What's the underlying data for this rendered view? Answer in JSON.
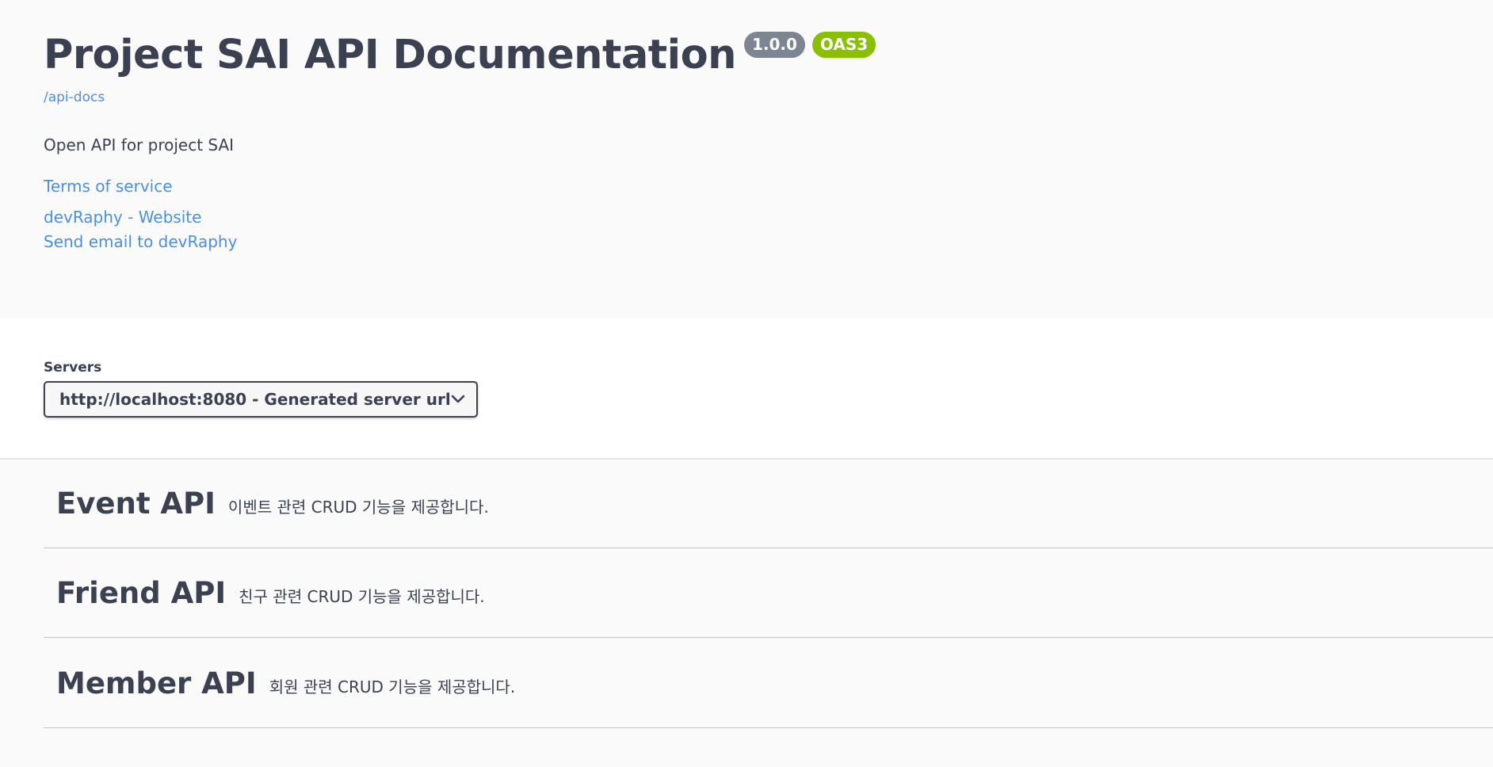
{
  "info": {
    "title": "Project SAI API Documentation",
    "version_badge": "1.0.0",
    "oas_badge": "OAS3",
    "spec_link": "/api-docs",
    "description": "Open API for project SAI",
    "terms_link": "Terms of service",
    "website_link": "devRaphy - Website",
    "email_link": "Send email to devRaphy"
  },
  "servers": {
    "label": "Servers",
    "selected": "http://localhost:8080 - Generated server url"
  },
  "tags": [
    {
      "name": "Event API",
      "description": "이벤트 관련 CRUD 기능을 제공합니다."
    },
    {
      "name": "Friend API",
      "description": "친구 관련 CRUD 기능을 제공합니다."
    },
    {
      "name": "Member API",
      "description": "회원 관련 CRUD 기능을 제공합니다."
    }
  ],
  "colors": {
    "link": "#4990e2",
    "text": "#3b4151",
    "version_badge": "#7d8492",
    "oas_badge": "#89bf04"
  }
}
